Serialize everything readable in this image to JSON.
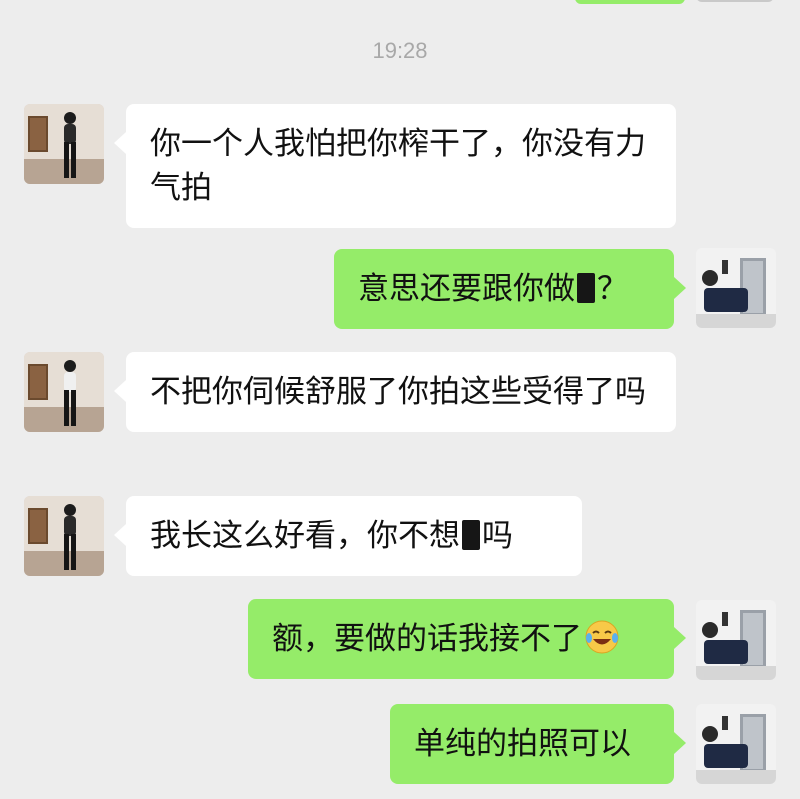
{
  "chat": {
    "timestamp": "19:28",
    "messages": [
      {
        "side": "in",
        "text": "你一个人我怕把你榨干了，你没有力气拍"
      },
      {
        "side": "out",
        "text_before": "意思还要跟你做",
        "text_after": "？",
        "redacted": true
      },
      {
        "side": "in",
        "text": "不把你伺候舒服了你拍这些受得了吗"
      },
      {
        "side": "in",
        "text_before": "我长这么好看，你不想",
        "text_after": "吗",
        "redacted": true
      },
      {
        "side": "out",
        "text": "额，要做的话我接不了",
        "emoji": "crying-laughing-emoji"
      },
      {
        "side": "out",
        "text": "单纯的拍照可以"
      }
    ]
  },
  "colors": {
    "background": "#ededed",
    "incoming_bubble": "#ffffff",
    "outgoing_bubble": "#95ec69"
  }
}
